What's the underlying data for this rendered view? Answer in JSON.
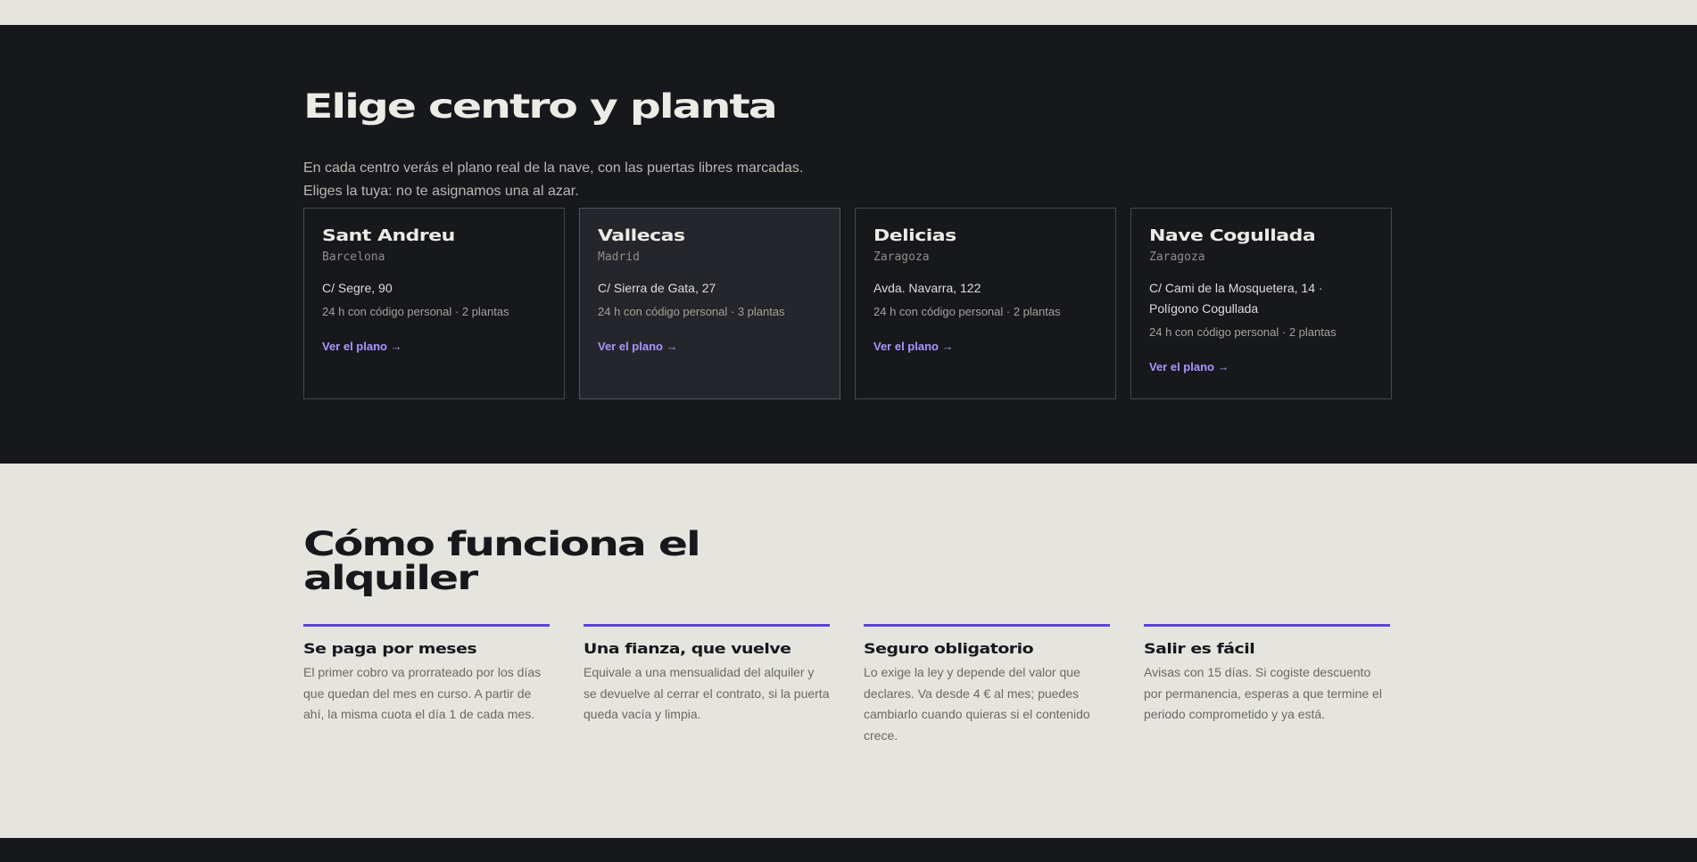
{
  "centers": {
    "title": "Elige centro y planta",
    "subtitle_line1": "En cada centro verás el plano real de la nave, con las puertas libres marcadas.",
    "subtitle_line2": "Eliges la tuya: no te asignamos una al azar.",
    "cards": [
      {
        "name": "Sant Andreu",
        "city": "Barcelona",
        "address": "C/ Segre, 90",
        "meta": "24 h con código personal · 2 plantas",
        "link": "Ver el plano →"
      },
      {
        "name": "Vallecas",
        "city": "Madrid",
        "address": "C/ Sierra de Gata, 27",
        "meta": "24 h con código personal · 3 plantas",
        "link": "Ver el plano →"
      },
      {
        "name": "Delicias",
        "city": "Zaragoza",
        "address": "Avda. Navarra, 122",
        "meta": "24 h con código personal · 2 plantas",
        "link": "Ver el plano →"
      },
      {
        "name": "Nave Cogullada",
        "city": "Zaragoza",
        "address": "C/ Cami de la Mosquetera, 14 · Polígono Cogullada",
        "meta": "24 h con código personal · 2 plantas",
        "link": "Ver el plano →"
      }
    ]
  },
  "rental": {
    "title": "Cómo funciona el alquiler",
    "steps": [
      {
        "title": "Se paga por meses",
        "text": "El primer cobro va prorrateado por los días que quedan del mes en curso. A partir de ahí, la misma cuota el día 1 de cada mes."
      },
      {
        "title": "Una fianza, que vuelve",
        "text": "Equivale a una mensualidad del alquiler y se devuelve al cerrar el contrato, si la puerta queda vacía y limpia."
      },
      {
        "title": "Seguro obligatorio",
        "text": "Lo exige la ley y depende del valor que declares. Va desde 4 € al mes; puedes cambiarlo cuando quieras si el contenido crece."
      },
      {
        "title": "Salir es fácil",
        "text": "Avisas con 15 días. Si cogiste descuento por permanencia, esperas a que termine el periodo comprometido y ya está."
      }
    ]
  },
  "colors": {
    "accent": "#5b45d9",
    "link": "#a796ff",
    "dark_bg": "#17181c",
    "light_bg": "#e6e4df"
  }
}
